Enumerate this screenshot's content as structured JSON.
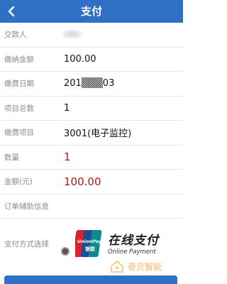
{
  "header": {
    "title": "支付",
    "back_icon": "chevron-left-icon"
  },
  "rows": [
    {
      "label": "交款人",
      "value": ""
    },
    {
      "label": "缴纳金额",
      "value": "100.00"
    },
    {
      "label": "缴费日期",
      "value": "201▒▒▒03"
    },
    {
      "label": "项目总数",
      "value": "1"
    },
    {
      "label": "缴费项目",
      "value": "3001(电子监控)"
    },
    {
      "label": "数量",
      "value": "1"
    },
    {
      "label": "金额(元)",
      "value": "100.00"
    },
    {
      "label": "订单辅助信息",
      "value": ""
    }
  ],
  "payment": {
    "label": "支付方式选择",
    "option_cn": "在线支付",
    "option_en": "Online Payment",
    "logo_text_top": "UnionPay",
    "logo_text_bottom": "银联"
  },
  "watermark": {
    "text": "奇贝智能"
  },
  "colors": {
    "header": "#2f6fc4",
    "accent_red": "#b01818"
  }
}
